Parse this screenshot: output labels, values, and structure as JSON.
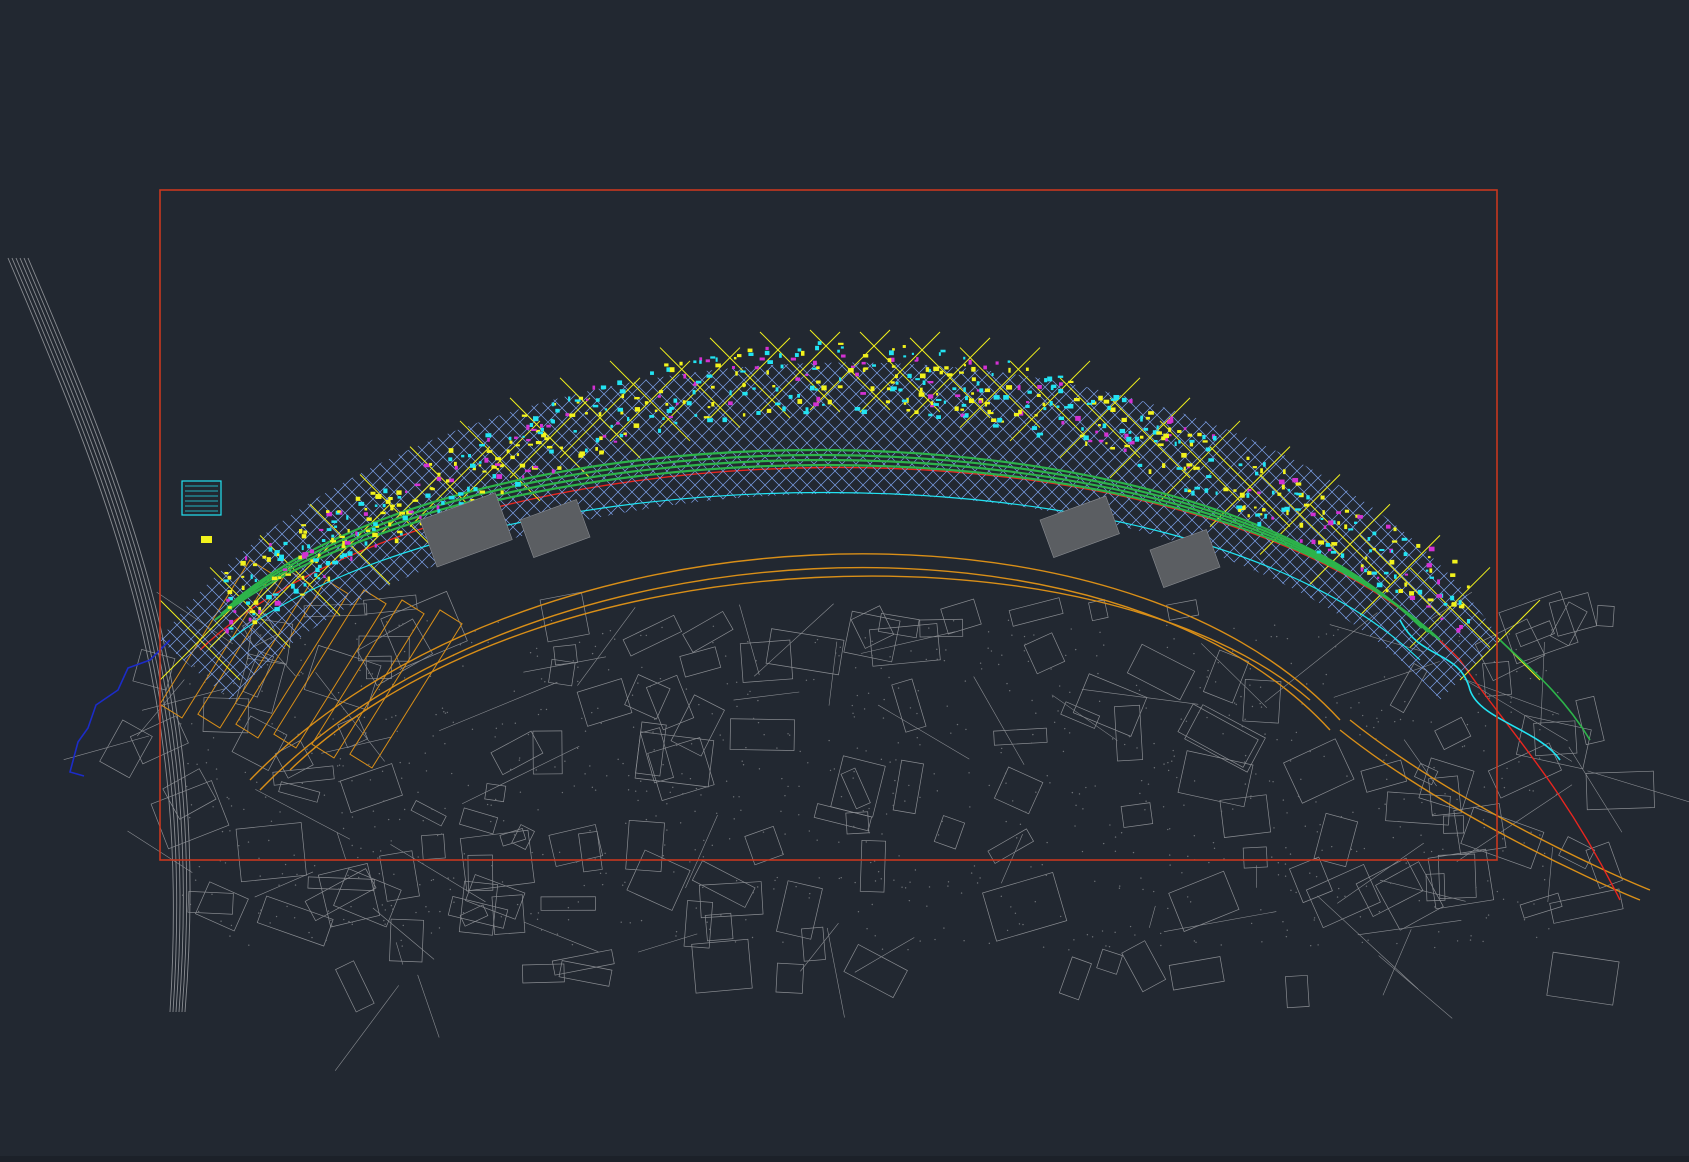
{
  "viewport": {
    "background": "#222831",
    "frame_color": "#c8381e"
  },
  "layers": {
    "base_map": "#8a8d92",
    "grid": "#7c9fe8",
    "grid_labels": "#f2f21c",
    "green_area": "#2db34a",
    "cyan_detail": "#22e3f2",
    "magenta_detail": "#d331d3",
    "red_boundary": "#e8261f",
    "orange_road": "#d98f18",
    "blue_stream": "#1c2cc8"
  },
  "legend_block": {
    "color": "#22e3f2"
  },
  "icons": [
    "legend-icon",
    "title-marker-icon"
  ]
}
